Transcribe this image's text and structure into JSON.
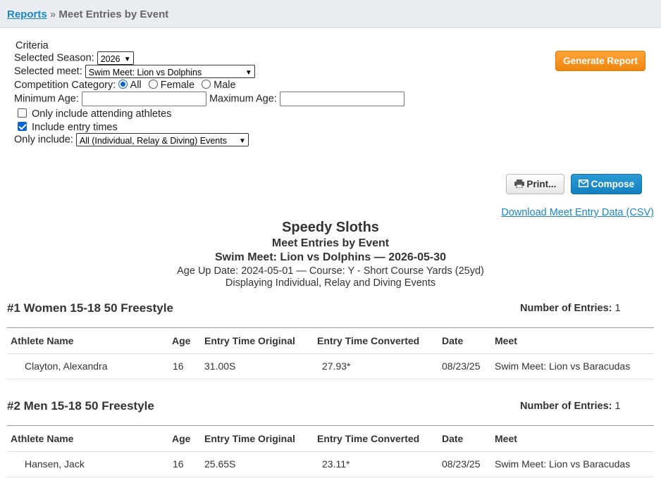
{
  "breadcrumb": {
    "link": "Reports",
    "separator": "»",
    "current": "Meet Entries by Event"
  },
  "criteria": {
    "heading": "Criteria",
    "season_label": "Selected Season:",
    "season_value": "2026",
    "meet_label": "Selected meet:",
    "meet_value": "Swim Meet: Lion vs Dolphins",
    "category_label": "Competition Category:",
    "category_options": [
      "All",
      "Female",
      "Male"
    ],
    "category_selected": "All",
    "min_age_label": "Minimum Age:",
    "min_age_value": "",
    "max_age_label": "Maximum Age:",
    "max_age_value": "",
    "attending_label": "Only include attending athletes",
    "attending_checked": false,
    "entry_times_label": "Include entry times",
    "entry_times_checked": true,
    "only_include_label": "Only include:",
    "only_include_value": "All (Individual, Relay & Diving) Events"
  },
  "buttons": {
    "generate": "Generate Report",
    "print": "Print...",
    "compose": "Compose",
    "csv": "Download Meet Entry Data (CSV)"
  },
  "report": {
    "team": "Speedy Sloths",
    "title": "Meet Entries by Event",
    "meet": "Swim Meet: Lion vs Dolphins — 2026-05-30",
    "age_course": "Age Up Date: 2024-05-01 — Course: Y - Short Course Yards (25yd)",
    "display": "Displaying Individual, Relay and Diving Events"
  },
  "columns": [
    "Athlete Name",
    "Age",
    "Entry Time Original",
    "Entry Time Converted",
    "Date",
    "Meet"
  ],
  "count_label": "Number of Entries:",
  "events": [
    {
      "title": "#1 Women 15-18 50 Freestyle",
      "count": "1",
      "rows": [
        {
          "name": "Clayton, Alexandra",
          "age": "16",
          "orig": "31.00S",
          "conv": "27.93*",
          "date": "08/23/25",
          "meet": "Swim Meet: Lion vs Baracudas"
        }
      ]
    },
    {
      "title": "#2 Men 15-18 50 Freestyle",
      "count": "1",
      "rows": [
        {
          "name": "Hansen, Jack",
          "age": "16",
          "orig": "25.65S",
          "conv": "23.11*",
          "date": "08/23/25",
          "meet": "Swim Meet: Lion vs Baracudas"
        }
      ]
    }
  ]
}
